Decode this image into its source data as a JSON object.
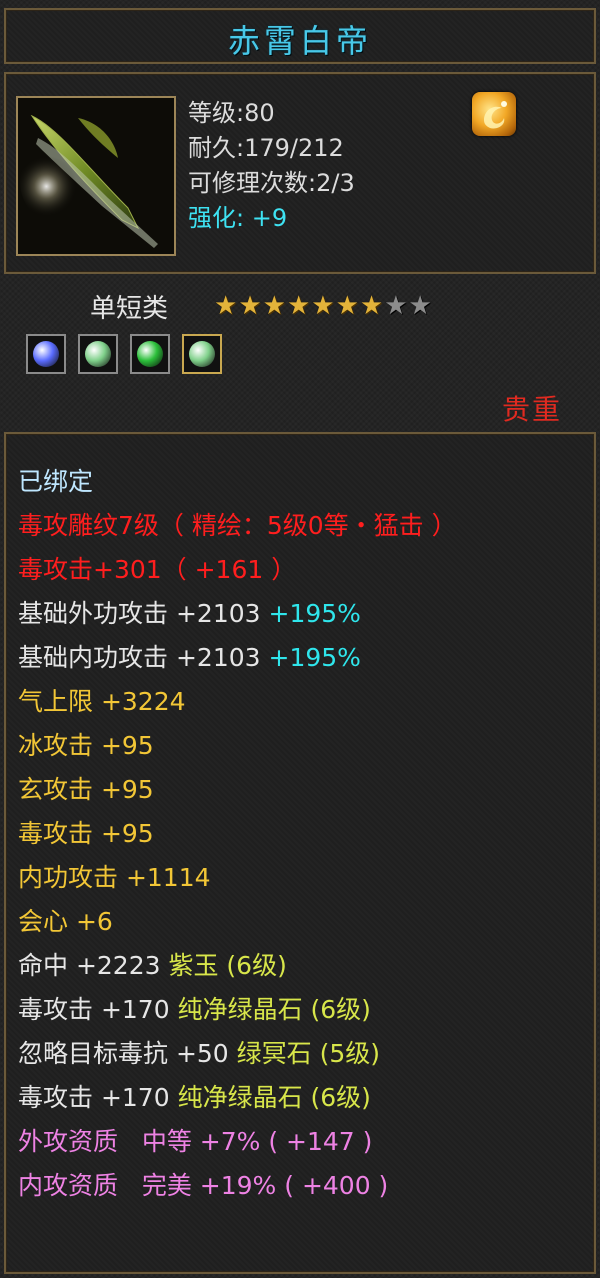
{
  "item": {
    "name": "赤霄白帝",
    "level": "等级:80",
    "durability": "耐久:179/212",
    "repairs": "可修理次数:2/3",
    "enhance_label": "强化:",
    "enhance_value": "+9",
    "badge_icon": "gold-emblem-icon",
    "weapon_icon": "green-blade-weapon-icon",
    "type": "单短类",
    "stars_filled": 7,
    "stars_total": 9,
    "rarity": "贵重"
  },
  "gems": [
    {
      "icon": "blue-gem-icon",
      "color": "#5a6cff"
    },
    {
      "icon": "green-white-gem-icon",
      "color": "#7fd08a"
    },
    {
      "icon": "green-crystal-icon",
      "color": "#2bbf3a"
    },
    {
      "icon": "green-white-gem-icon",
      "color": "#7fd08a"
    }
  ],
  "stats": {
    "bound": "已绑定",
    "engrave": "毒攻雕纹7级（ 精绘：5级0等・猛击 ）",
    "poison_atk_main": "毒攻击+301（ +161 ）",
    "base_ext_label": "基础外功攻击",
    "base_ext_value": "+2103",
    "base_ext_pct": "+195%",
    "base_int_label": "基础内功攻击",
    "base_int_value": "+2103",
    "base_int_pct": "+195%",
    "qi_max": "气上限 +3224",
    "ice_atk": "冰攻击 +95",
    "mystic_atk": "玄攻击 +95",
    "poison_atk": "毒攻击 +95",
    "int_atk": "内功攻击 +1114",
    "crit": "会心 +6",
    "accuracy_label": "命中 +2223",
    "accuracy_gem": "紫玉 (6级)",
    "poison_gem1_label": "毒攻击 +170",
    "poison_gem1_gem": "纯净绿晶石 (6级)",
    "ignore_res_label": "忽略目标毒抗 +50",
    "ignore_res_gem": "绿冥石 (5级)",
    "poison_gem2_label": "毒攻击 +170",
    "poison_gem2_gem": "纯净绿晶石 (6级)",
    "ext_aptitude": "外攻资质   中等 +7% ( +147 )",
    "int_aptitude": "内攻资质   完美 +19% ( +400 )"
  },
  "colors": {
    "title": "#48c8e8",
    "rarity": "#e02a20",
    "stat_yellow": "#f2c636",
    "stat_red": "#ff1e1e",
    "stat_cyan": "#2fe6ec",
    "stat_pink": "#ee82e4",
    "star_on": "#e3b33a",
    "star_off": "#8c8c8c"
  }
}
